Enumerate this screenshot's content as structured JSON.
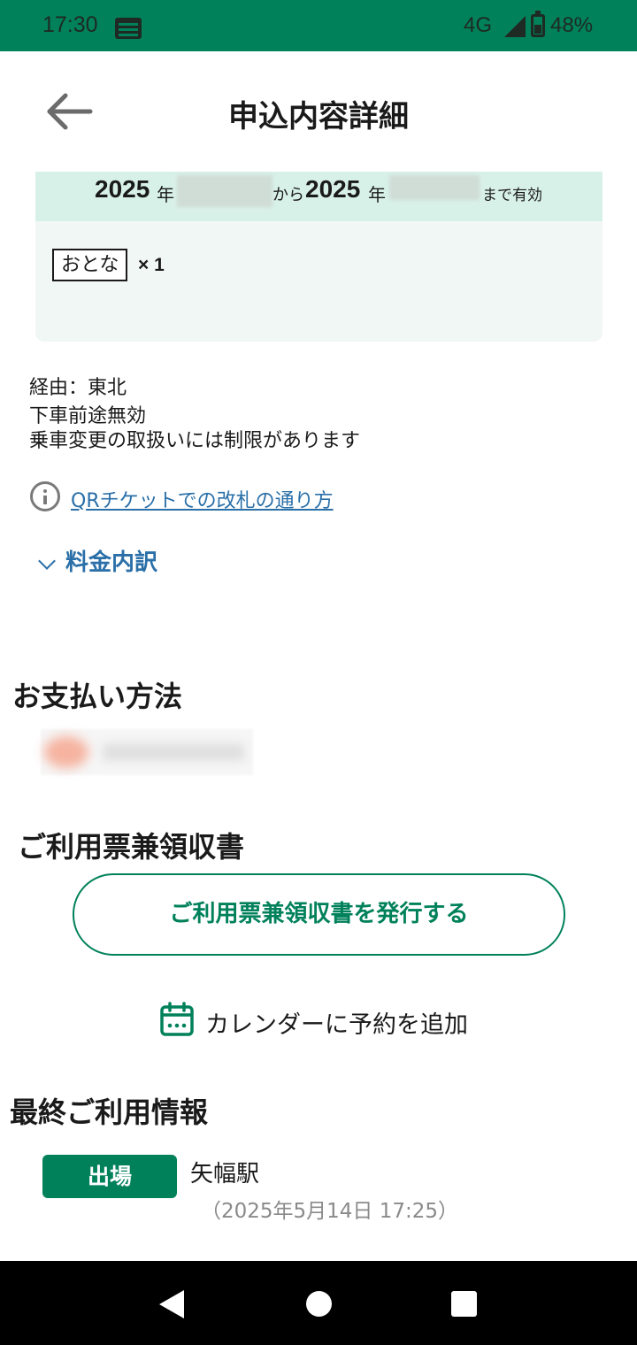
{
  "status_bar": {
    "time": "17:30",
    "network": "4G",
    "battery": "48%",
    "app_icon": "notification-app-icon",
    "signal_icon": "signal-icon",
    "battery_icon": "battery-icon",
    "background": "#00815a"
  },
  "header": {
    "back_icon": "arrow-left-icon",
    "title": "申込内容詳細"
  },
  "ticket": {
    "validity": {
      "from_year": "2025",
      "year_suffix": "年",
      "from_suffix": "から",
      "to_year": "2025",
      "to_suffix": "まで有効"
    },
    "passenger_type": "おとな",
    "passenger_count": "× 1",
    "card_background": "#f1f7f4",
    "validity_background": "#d8f1e8"
  },
  "route_notes": {
    "via": "経由：東北",
    "note1": "下車前途無効",
    "note2": "乗車変更の取扱いには制限があります"
  },
  "qr_info": {
    "icon": "info-icon",
    "link_text": "QRチケットでの改札の通り方"
  },
  "fare_breakdown": {
    "icon": "chevron-down-icon",
    "label": "料金内訳"
  },
  "payment": {
    "title": "お支払い方法"
  },
  "receipt": {
    "title": "ご利用票兼領収書",
    "button_label": "ご利用票兼領収書を発行する"
  },
  "calendar": {
    "icon": "calendar-icon",
    "label": "カレンダーに予約を追加"
  },
  "last_usage": {
    "title": "最終ご利用情報",
    "badge": "出場",
    "station": "矢幅駅",
    "timestamp": "（2025年5月14日 17:25）"
  },
  "navigation": {
    "back_icon": "nav-back-icon",
    "home_icon": "nav-home-icon",
    "recents_icon": "nav-recents-icon"
  },
  "colors": {
    "brand_green": "#00815a",
    "link_blue": "#2a6fa8"
  }
}
